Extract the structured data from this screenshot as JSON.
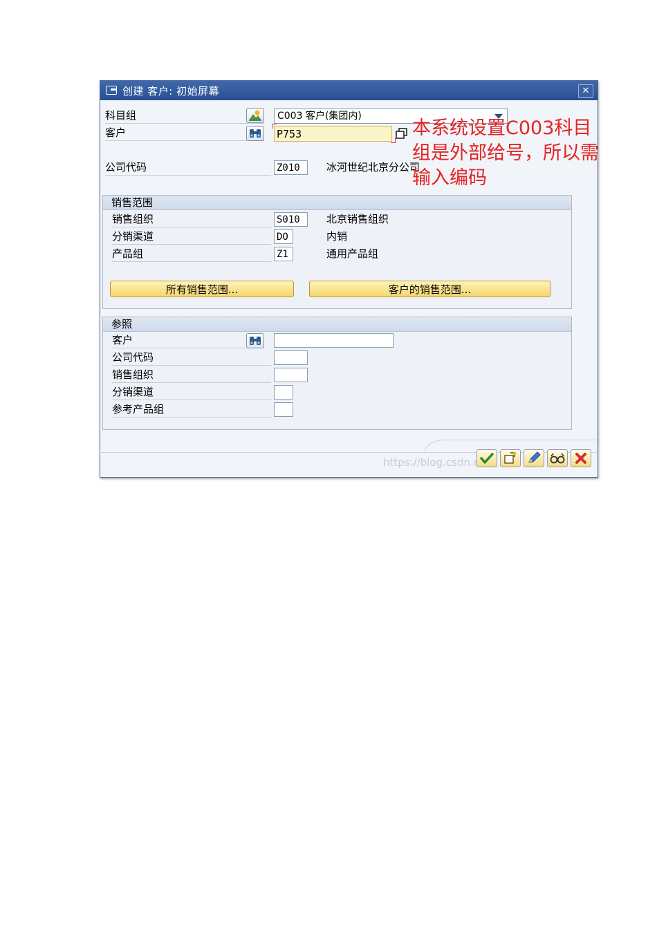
{
  "window": {
    "title": "创建 客户: 初始屏幕",
    "close_label": "✕"
  },
  "header_fields": {
    "account_group": {
      "label": "科目组",
      "value": "C003 客户(集团内)"
    },
    "customer": {
      "label": "客户",
      "value": "P753"
    },
    "company_code": {
      "label": "公司代码",
      "value": "Z010",
      "description": "冰河世纪北京分公司"
    }
  },
  "annotation": {
    "text": "本系统设置C003科目组是外部给号，所以需输入编码"
  },
  "sales_area": {
    "title": "销售范围",
    "sales_org": {
      "label": "销售组织",
      "value": "S010",
      "description": "北京销售组织"
    },
    "distribution_channel": {
      "label": "分销渠道",
      "value": "DO",
      "description": "内销"
    },
    "division": {
      "label": "产品组",
      "value": "Z1",
      "description": "通用产品组"
    },
    "all_sales_areas_button": "所有销售范围...",
    "customer_sales_areas_button": "客户的销售范围..."
  },
  "reference": {
    "title": "参照",
    "customer": {
      "label": "客户",
      "value": ""
    },
    "company_code": {
      "label": "公司代码",
      "value": ""
    },
    "sales_org": {
      "label": "销售组织",
      "value": ""
    },
    "distribution_channel": {
      "label": "分销渠道",
      "value": ""
    },
    "division": {
      "label": "参考产品组",
      "value": ""
    }
  },
  "watermark": "https://blog.csdn.net/",
  "colors": {
    "title_bar": "#2a4f91",
    "annotation": "#e42424",
    "required_field": "#fbf4c9",
    "button": "#f6d66e"
  },
  "icons": {
    "account_group": "landscape-icon",
    "customer_search": "binoculars-icon",
    "copy": "copy-icon",
    "toolbar": [
      "check-icon",
      "new-entries-icon",
      "edit-icon",
      "display-icon",
      "cancel-icon"
    ]
  }
}
